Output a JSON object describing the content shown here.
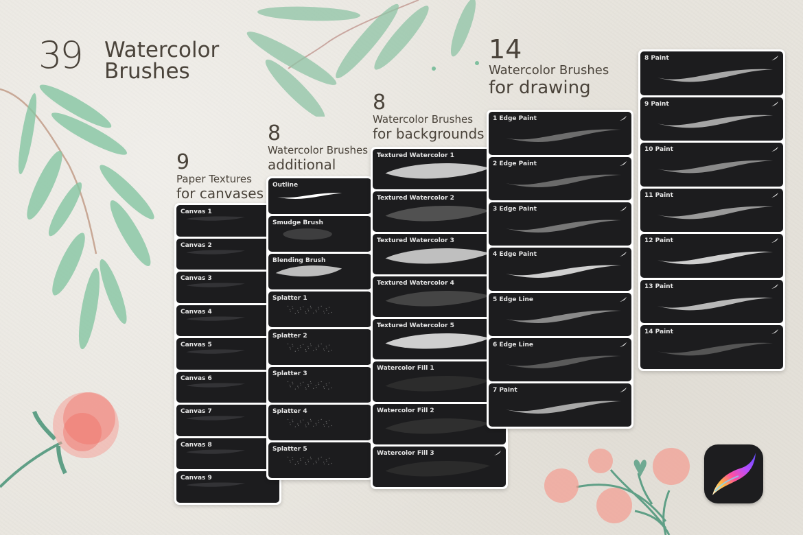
{
  "title": {
    "count": "39",
    "line1": "Watercolor",
    "line2": "Brushes"
  },
  "sections": [
    {
      "id": "canvases",
      "count": "9",
      "line1": "Paper Textures",
      "line2": "for canvases",
      "items": [
        "Canvas 1",
        "Canvas 2",
        "Canvas 3",
        "Canvas 4",
        "Canvas 5",
        "Canvas 6",
        "Canvas 7",
        "Canvas 8",
        "Canvas 9"
      ]
    },
    {
      "id": "additional",
      "count": "8",
      "line1": "Watercolor Brushes",
      "line2": "additional",
      "items": [
        "Outline",
        "Smudge Brush",
        "Blending Brush",
        "Splatter 1",
        "Splatter 2",
        "Splatter 3",
        "Splatter 4",
        "Splatter 5"
      ]
    },
    {
      "id": "backgrounds",
      "count": "8",
      "line1": "Watercolor Brushes",
      "line2": "for backgrounds",
      "items": [
        "Textured Watercolor 1",
        "Textured Watercolor 2",
        "Textured Watercolor 3",
        "Textured Watercolor 4",
        "Textured Watercolor 5",
        "Watercolor Fill 1",
        "Watercolor Fill 2",
        "Watercolor Fill 3"
      ]
    },
    {
      "id": "drawing",
      "count": "14",
      "line1": "Watercolor Brushes",
      "line2": "for drawing",
      "items": [
        "1 Edge Paint",
        "2 Edge Paint",
        "3 Edge Paint",
        "4 Edge Paint",
        "5 Edge Line",
        "6 Edge Line",
        "7 Paint",
        "8 Paint",
        "9 Paint",
        "10 Paint",
        "11 Paint",
        "12 Paint",
        "13 Paint",
        "14 Paint"
      ]
    }
  ],
  "app_icon": {
    "name": "procreate-icon"
  },
  "colors": {
    "background": "#e8e5de",
    "text": "#4a433a",
    "card": "#1c1c1e",
    "leaf": "#7fbf9e",
    "flower": "#f07a70"
  }
}
